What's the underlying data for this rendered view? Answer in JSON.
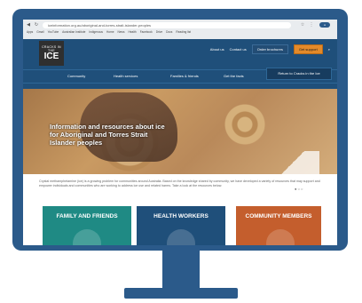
{
  "browser": {
    "url": "iceinformation.org.au/aboriginal-and-torres-strait-islander-peoples",
    "bookmarks": [
      "Apps",
      "Gmail",
      "YouTube",
      "Australian Institute",
      "Indigenous",
      "Home",
      "News",
      "Health",
      "Facebook",
      "Drive",
      "Docs",
      "Reading list"
    ]
  },
  "site": {
    "logo_top": "CRACKS IN THE",
    "logo_main": "ICE",
    "top_links": {
      "about": "About us",
      "contact": "Contact us",
      "brochure": "Order brochures",
      "support": "Get support"
    },
    "nav": {
      "community": "Community",
      "health": "Health services",
      "families": "Families & friends",
      "facts": "Get the facts"
    },
    "return_button": "Return to Cracks in the Ice"
  },
  "hero": {
    "text": "Information and resources about ice for Aboriginal and Torres Strait Islander peoples"
  },
  "intro": "Crystal methamphetamine (ice) is a growing problem for communities around Australia. Based on the knowledge shared by community, we have developed a variety of resources that may support and empower individuals and communities who are working to address ice use and related harms. Take a look at the resources below.",
  "cards": {
    "family": "FAMILY AND FRIENDS",
    "health": "HEALTH WORKERS",
    "community": "COMMUNITY MEMBERS"
  },
  "colors": {
    "monitor": "#2b5a8a",
    "header": "#1f4f7a",
    "card_family": "#1f8a84",
    "card_health": "#1f4f7a",
    "card_community": "#c45e2d",
    "accent_orange": "#e38a2a"
  }
}
